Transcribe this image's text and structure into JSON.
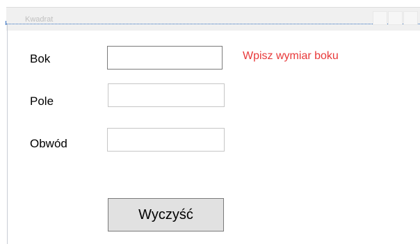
{
  "window": {
    "title": "Kwadrat"
  },
  "form": {
    "side_label": "Bok",
    "side_value": "",
    "area_label": "Pole",
    "area_value": "",
    "perimeter_label": "Obwód",
    "perimeter_value": "",
    "hint_text": "Wpisz wymiar boku",
    "hint_color": "#e8393a",
    "clear_button_label": "Wyczyść"
  }
}
